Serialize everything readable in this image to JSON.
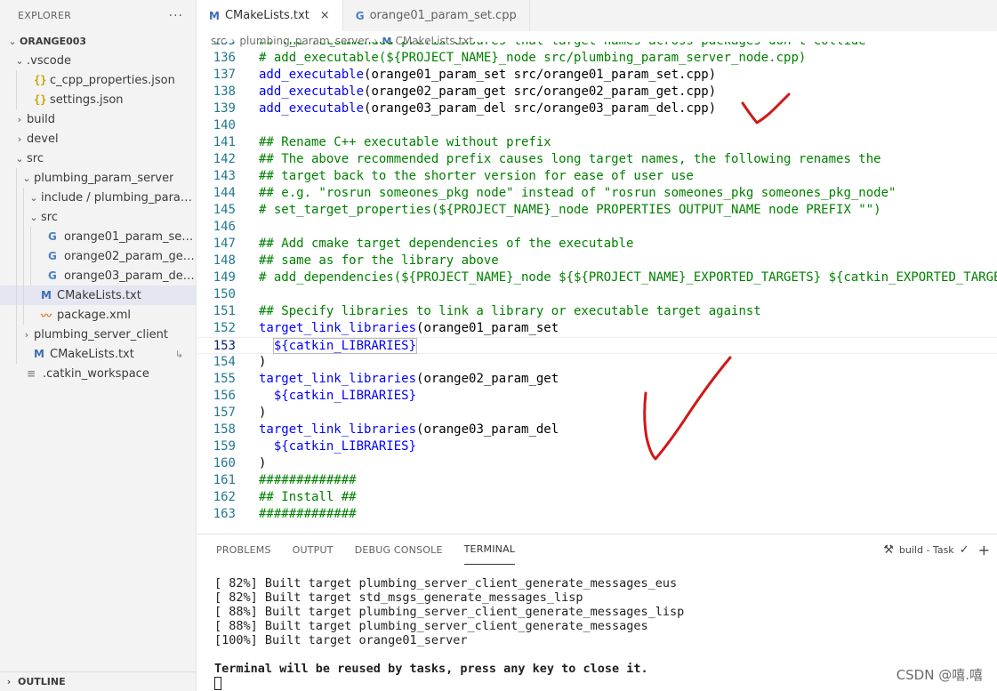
{
  "sidebar": {
    "header": "EXPLORER",
    "more": "···",
    "outline": "OUTLINE",
    "tree": [
      {
        "label": "ORANGE003",
        "depth": 0,
        "chevron": "down",
        "icon": "",
        "bold": true
      },
      {
        "label": ".vscode",
        "depth": 1,
        "chevron": "down",
        "icon": ""
      },
      {
        "label": "c_cpp_properties.json",
        "depth": 2,
        "chevron": "",
        "icon": "json"
      },
      {
        "label": "settings.json",
        "depth": 2,
        "chevron": "",
        "icon": "json"
      },
      {
        "label": "build",
        "depth": 1,
        "chevron": "right",
        "icon": ""
      },
      {
        "label": "devel",
        "depth": 1,
        "chevron": "right",
        "icon": ""
      },
      {
        "label": "src",
        "depth": 1,
        "chevron": "down",
        "icon": ""
      },
      {
        "label": "plumbing_param_server",
        "depth": 2,
        "chevron": "down",
        "icon": ""
      },
      {
        "label": "include / plumbing_param...",
        "depth": 3,
        "chevron": "down",
        "icon": ""
      },
      {
        "label": "src",
        "depth": 3,
        "chevron": "down",
        "icon": ""
      },
      {
        "label": "orange01_param_set.cpp",
        "depth": 4,
        "chevron": "",
        "icon": "cpp"
      },
      {
        "label": "orange02_param_get.cpp",
        "depth": 4,
        "chevron": "",
        "icon": "cpp"
      },
      {
        "label": "orange03_param_del.cpp",
        "depth": 4,
        "chevron": "",
        "icon": "cpp"
      },
      {
        "label": "CMakeLists.txt",
        "depth": 3,
        "chevron": "",
        "icon": "m",
        "selected": true
      },
      {
        "label": "package.xml",
        "depth": 3,
        "chevron": "",
        "icon": "rss"
      },
      {
        "label": "plumbing_server_client",
        "depth": 2,
        "chevron": "right",
        "icon": ""
      },
      {
        "label": "CMakeLists.txt",
        "depth": 2,
        "chevron": "",
        "icon": "m",
        "trail": "↳"
      },
      {
        "label": ".catkin_workspace",
        "depth": 1,
        "chevron": "",
        "icon": "lines"
      }
    ]
  },
  "tabs": [
    {
      "label": "CMakeLists.txt",
      "icon": "M",
      "active": true,
      "close": "×"
    },
    {
      "label": "orange01_param_set.cpp",
      "icon": "G",
      "active": false
    }
  ],
  "breadcrumb": [
    "src",
    "plumbing_param_server",
    "CMakeLists.txt"
  ],
  "code": [
    {
      "n": "135",
      "segs": [
        {
          "c": "cm",
          "t": "## The recommended prefix ensures that target names across packages don't collide"
        }
      ]
    },
    {
      "n": "136",
      "segs": [
        {
          "c": "cm",
          "t": "# add_executable(${PROJECT_NAME}_node src/plumbing_param_server_node.cpp)"
        }
      ]
    },
    {
      "n": "137",
      "segs": [
        {
          "c": "fn",
          "t": "add_executable"
        },
        {
          "c": "",
          "t": "(orange01_param_set src/orange01_param_set.cpp)"
        }
      ]
    },
    {
      "n": "138",
      "segs": [
        {
          "c": "fn",
          "t": "add_executable"
        },
        {
          "c": "",
          "t": "(orange02_param_get src/orange02_param_get.cpp)"
        }
      ]
    },
    {
      "n": "139",
      "segs": [
        {
          "c": "fn",
          "t": "add_executable"
        },
        {
          "c": "",
          "t": "(orange03_param_del src/orange03_param_del.cpp)"
        }
      ]
    },
    {
      "n": "140",
      "segs": []
    },
    {
      "n": "141",
      "segs": [
        {
          "c": "cm",
          "t": "## Rename C++ executable without prefix"
        }
      ]
    },
    {
      "n": "142",
      "segs": [
        {
          "c": "cm",
          "t": "## The above recommended prefix causes long target names, the following renames the"
        }
      ]
    },
    {
      "n": "143",
      "segs": [
        {
          "c": "cm",
          "t": "## target back to the shorter version for ease of user use"
        }
      ]
    },
    {
      "n": "144",
      "segs": [
        {
          "c": "cm",
          "t": "## e.g. \"rosrun someones_pkg node\" instead of \"rosrun someones_pkg someones_pkg_node\""
        }
      ]
    },
    {
      "n": "145",
      "segs": [
        {
          "c": "cm",
          "t": "# set_target_properties(${PROJECT_NAME}_node PROPERTIES OUTPUT_NAME node PREFIX \"\")"
        }
      ]
    },
    {
      "n": "146",
      "segs": []
    },
    {
      "n": "147",
      "segs": [
        {
          "c": "cm",
          "t": "## Add cmake target dependencies of the executable"
        }
      ]
    },
    {
      "n": "148",
      "segs": [
        {
          "c": "cm",
          "t": "## same as for the library above"
        }
      ]
    },
    {
      "n": "149",
      "segs": [
        {
          "c": "cm",
          "t": "# add_dependencies(${PROJECT_NAME}_node ${${PROJECT_NAME}_EXPORTED_TARGETS} ${catkin_EXPORTED_TARGETS})"
        }
      ]
    },
    {
      "n": "150",
      "segs": []
    },
    {
      "n": "151",
      "segs": [
        {
          "c": "cm",
          "t": "## Specify libraries to link a library or executable target against"
        }
      ]
    },
    {
      "n": "152",
      "segs": [
        {
          "c": "fn",
          "t": "target_link_libraries"
        },
        {
          "c": "",
          "t": "(orange01_param_set"
        }
      ]
    },
    {
      "n": "153",
      "cur": true,
      "segs": [
        {
          "c": "",
          "t": "  "
        },
        {
          "c": "fn bracket",
          "t": "${catkin_LIBRARIES}"
        }
      ]
    },
    {
      "n": "154",
      "segs": [
        {
          "c": "",
          "t": ")"
        }
      ]
    },
    {
      "n": "155",
      "segs": [
        {
          "c": "fn",
          "t": "target_link_libraries"
        },
        {
          "c": "",
          "t": "(orange02_param_get"
        }
      ]
    },
    {
      "n": "156",
      "segs": [
        {
          "c": "",
          "t": "  "
        },
        {
          "c": "fn",
          "t": "${catkin_LIBRARIES}"
        }
      ]
    },
    {
      "n": "157",
      "segs": [
        {
          "c": "",
          "t": ")"
        }
      ]
    },
    {
      "n": "158",
      "segs": [
        {
          "c": "fn",
          "t": "target_link_libraries"
        },
        {
          "c": "",
          "t": "(orange03_param_del"
        }
      ]
    },
    {
      "n": "159",
      "segs": [
        {
          "c": "",
          "t": "  "
        },
        {
          "c": "fn",
          "t": "${catkin_LIBRARIES}"
        }
      ]
    },
    {
      "n": "160",
      "segs": [
        {
          "c": "",
          "t": ")"
        }
      ]
    },
    {
      "n": "161",
      "segs": [
        {
          "c": "cm",
          "t": "#############"
        }
      ]
    },
    {
      "n": "162",
      "segs": [
        {
          "c": "cm",
          "t": "## Install ##"
        }
      ]
    },
    {
      "n": "163",
      "segs": [
        {
          "c": "cm",
          "t": "#############"
        }
      ]
    }
  ],
  "panel": {
    "tabs": [
      "PROBLEMS",
      "OUTPUT",
      "DEBUG CONSOLE",
      "TERMINAL"
    ],
    "active": "TERMINAL",
    "task": "build - Task",
    "terminal": [
      "[ 82%] Built target plumbing_server_client_generate_messages_eus",
      "[ 82%] Built target std_msgs_generate_messages_lisp",
      "[ 88%] Built target plumbing_server_client_generate_messages_lisp",
      "[ 88%] Built target plumbing_server_client_generate_messages",
      "[100%] Built target orange01_server",
      "",
      "Terminal will be reused by tasks, press any key to close it."
    ]
  },
  "watermark": "CSDN @嘻.嘻",
  "colors": {
    "comment": "#008000",
    "function": "#0000ff",
    "lineNumber": "#237893",
    "selection": "#e4e6f1",
    "annotation": "#d01818"
  }
}
